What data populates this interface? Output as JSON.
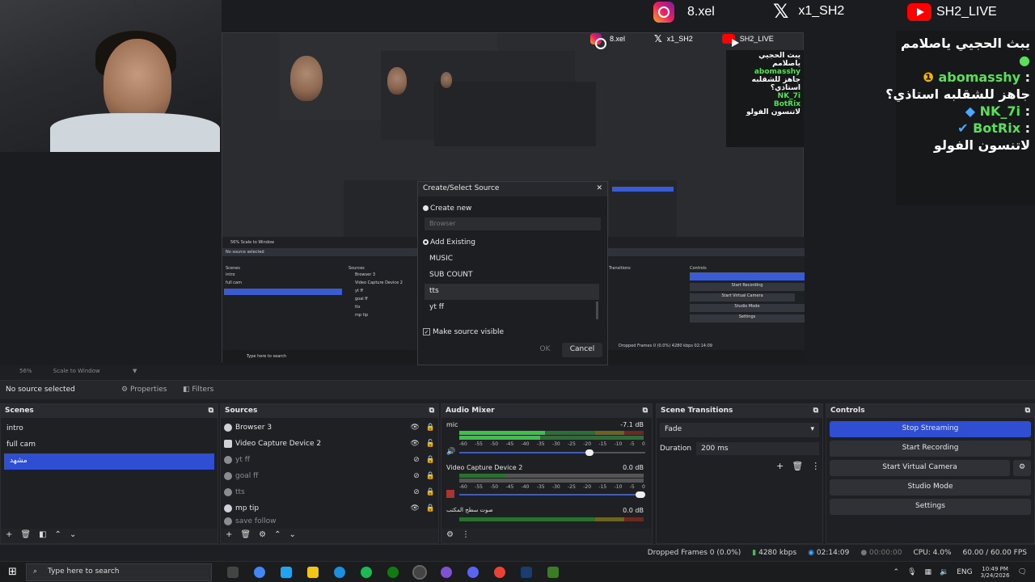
{
  "social": [
    {
      "icon": "instagram-icon",
      "handle": "8.xel"
    },
    {
      "icon": "x-icon",
      "handle": "x1_SH2"
    },
    {
      "icon": "youtube-icon",
      "handle": "SH2_LIVE"
    }
  ],
  "chat": {
    "line1": "يبث الحجيي ياصلامم",
    "user1": "abomasshy",
    "msg1": "جاهز للشقلبه استاذي؟",
    "user2": "NK_7i",
    "user3": "BotRix",
    "msg3": "لاتنسون الفولو"
  },
  "dialog": {
    "title": "Create/Select Source",
    "create_new": "Create new",
    "name_placeholder": "Browser",
    "add_existing": "Add Existing",
    "items": [
      "MUSIC",
      "SUB COUNT",
      "tts",
      "yt ff"
    ],
    "make_visible": "Make source visible",
    "ok": "OK",
    "cancel": "Cancel"
  },
  "preview": {
    "zoom": "56%",
    "scale": "Scale to Window"
  },
  "propbar": {
    "selected": "No source selected",
    "properties": "Properties",
    "filters": "Filters"
  },
  "scenes": {
    "title": "Scenes",
    "items": [
      "intro",
      "full cam",
      "مشهد"
    ]
  },
  "sources": {
    "title": "Sources",
    "items": [
      "Browser 3",
      "Video Capture Device 2",
      "yt ff",
      "goal ff",
      "tts",
      "mp tip",
      "save follow"
    ]
  },
  "mixer": {
    "title": "Audio Mixer",
    "ch1": "mic",
    "ch1_db": "-7.1 dB",
    "ch2": "Video Capture Device 2",
    "ch2_db": "0.0 dB",
    "ch3": "صوت سطح المكتب",
    "ch3_db": "0.0 dB",
    "scale": [
      "-60",
      "-55",
      "-50",
      "-45",
      "-40",
      "-35",
      "-30",
      "-25",
      "-20",
      "-15",
      "-10",
      "-5",
      "0"
    ]
  },
  "transitions": {
    "title": "Scene Transitions",
    "type": "Fade",
    "duration_label": "Duration",
    "duration": "200 ms"
  },
  "controls": {
    "title": "Controls",
    "stop_streaming": "Stop Streaming",
    "start_recording": "Start Recording",
    "virtual_cam": "Start Virtual Camera",
    "studio_mode": "Studio Mode",
    "settings": "Settings"
  },
  "status": {
    "dropped": "Dropped Frames 0 (0.0%)",
    "bitrate": "4280 kbps",
    "live_time": "02:14:09",
    "rec_time": "00:00:00",
    "cpu": "CPU: 4.0%",
    "fps": "60.00 / 60.00 FPS"
  },
  "taskbar": {
    "search": "Type here to search",
    "lang": "ENG",
    "time": "10:49 PM",
    "date": "3/24/2026"
  },
  "colors": {
    "accent": "#2f4ed1",
    "meter_green": "#3cc24a",
    "meter_yellow": "#c6b524",
    "meter_red": "#c43a2a"
  }
}
